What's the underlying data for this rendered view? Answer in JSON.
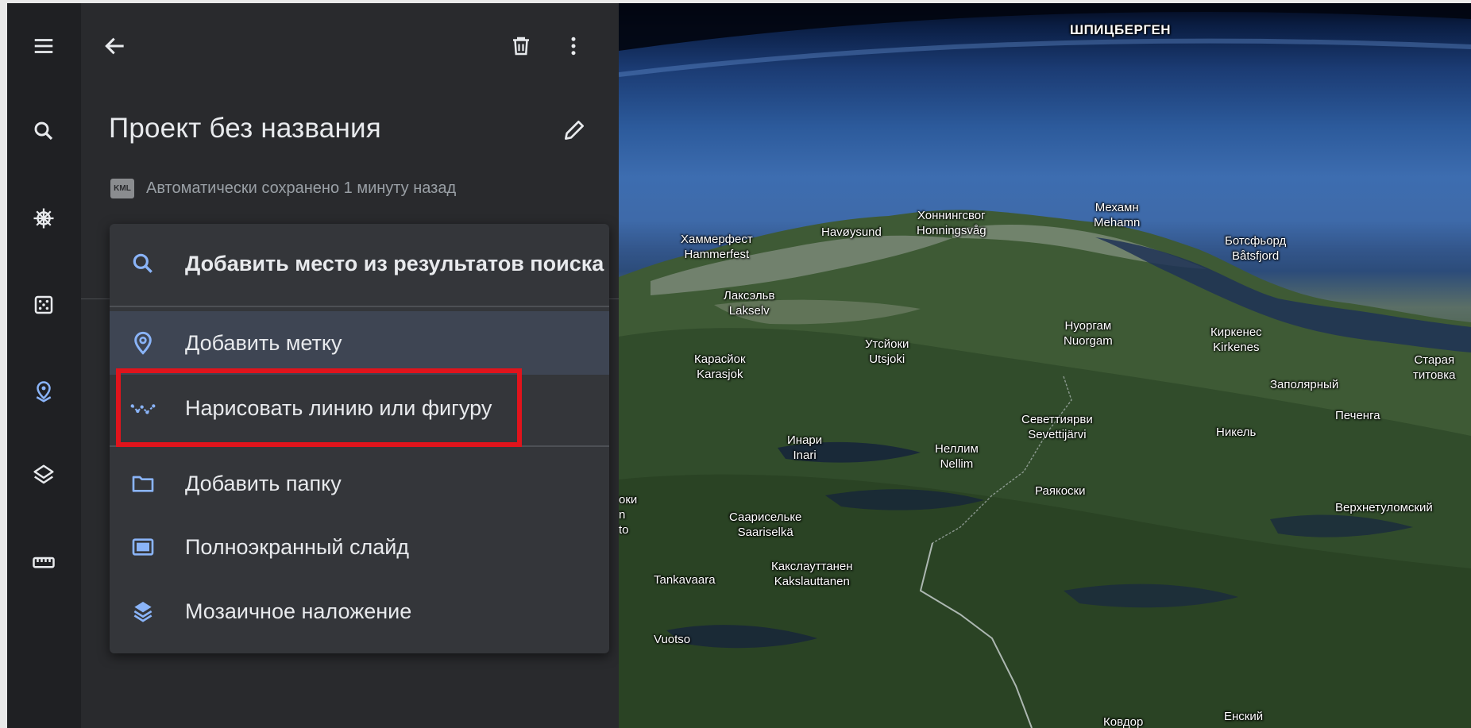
{
  "panel": {
    "title": "Проект без названия",
    "kml_badge": "KML",
    "saved_text": "Автоматически сохранено 1 минуту назад"
  },
  "menu": {
    "items": [
      {
        "label": "Добавить место из результатов поиска",
        "icon": "search-icon"
      },
      {
        "label": "Добавить метку",
        "icon": "location-pin-icon"
      },
      {
        "label": "Нарисовать линию или фигуру",
        "icon": "draw-line-icon"
      },
      {
        "label": "Добавить папку",
        "icon": "folder-icon"
      },
      {
        "label": "Полноэкранный слайд",
        "icon": "slide-icon"
      },
      {
        "label": "Мозаичное наложение",
        "icon": "layers-icon"
      }
    ]
  },
  "colors": {
    "accent_blue": "#8ab4f8",
    "highlight_box": "#e0141c",
    "panel_bg": "#292a2d",
    "menu_bg": "#34363a"
  },
  "map": {
    "labels": [
      {
        "text": "ШПИЦБЕРГЕН"
      },
      {
        "text": "Хаммерфест\nHammerfest"
      },
      {
        "text": "Havøysund"
      },
      {
        "text": "Хоннингсвог\nHonningsvåg"
      },
      {
        "text": "Мехамн\nMehamn"
      },
      {
        "text": "Ботсфьорд\nBåtsfjord"
      },
      {
        "text": "Лаксэльв\nLakselv"
      },
      {
        "text": "Нуоргам\nNuorgam"
      },
      {
        "text": "Киркенес\nKirkenes"
      },
      {
        "text": "Утсйоки\nUtsjoki"
      },
      {
        "text": "Карасйок\nKarasjok"
      },
      {
        "text": "Старая\nтитовка"
      },
      {
        "text": "Заполярный"
      },
      {
        "text": "Печенга"
      },
      {
        "text": "Севеттиярви\nSevettijärvi"
      },
      {
        "text": "Никель"
      },
      {
        "text": "Инари\nInari"
      },
      {
        "text": "Неллим\nNellim"
      },
      {
        "text": "Раякоски"
      },
      {
        "text": "Верхнетуломский"
      },
      {
        "text": "Саарисельке\nSaariselkä"
      },
      {
        "text": "Tankavaara"
      },
      {
        "text": "Какслауттанен\nKakslauttanen"
      },
      {
        "text": "Vuotso"
      },
      {
        "text": "Енский"
      },
      {
        "text": "Ковдор"
      },
      {
        "text": "оки\nn\nto"
      }
    ]
  }
}
